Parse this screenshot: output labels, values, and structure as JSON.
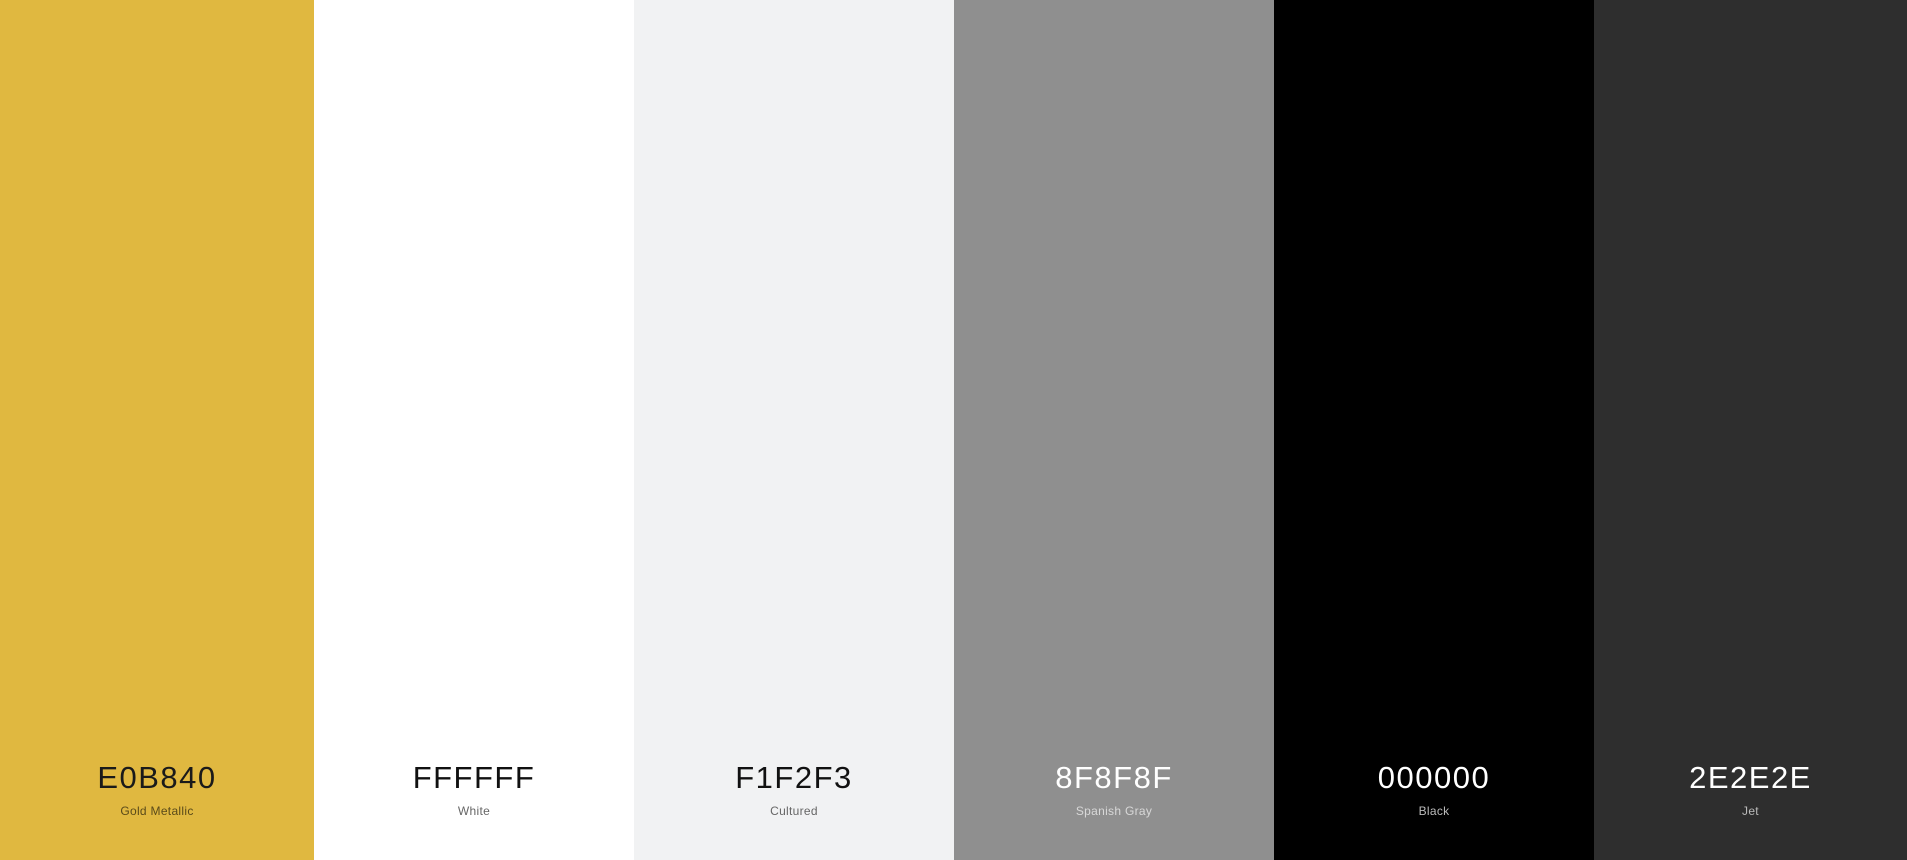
{
  "palette": {
    "swatches": [
      {
        "hex": "E0B840",
        "name": "Gold Metallic",
        "color": "#E0B840",
        "text_color": "#1a1a1a",
        "name_color": "#5a4a1a"
      },
      {
        "hex": "FFFFFF",
        "name": "White",
        "color": "#FFFFFF",
        "text_color": "#111111",
        "name_color": "#666666"
      },
      {
        "hex": "F1F2F3",
        "name": "Cultured",
        "color": "#F1F2F3",
        "text_color": "#111111",
        "name_color": "#666666"
      },
      {
        "hex": "8F8F8F",
        "name": "Spanish Gray",
        "color": "#8F8F8F",
        "text_color": "#ffffff",
        "name_color": "#d8d8d8"
      },
      {
        "hex": "000000",
        "name": "Black",
        "color": "#000000",
        "text_color": "#ffffff",
        "name_color": "#bbbbbb"
      },
      {
        "hex": "2E2E2E",
        "name": "Jet",
        "color": "#2E2E2E",
        "text_color": "#ffffff",
        "name_color": "#bbbbbb"
      }
    ]
  }
}
